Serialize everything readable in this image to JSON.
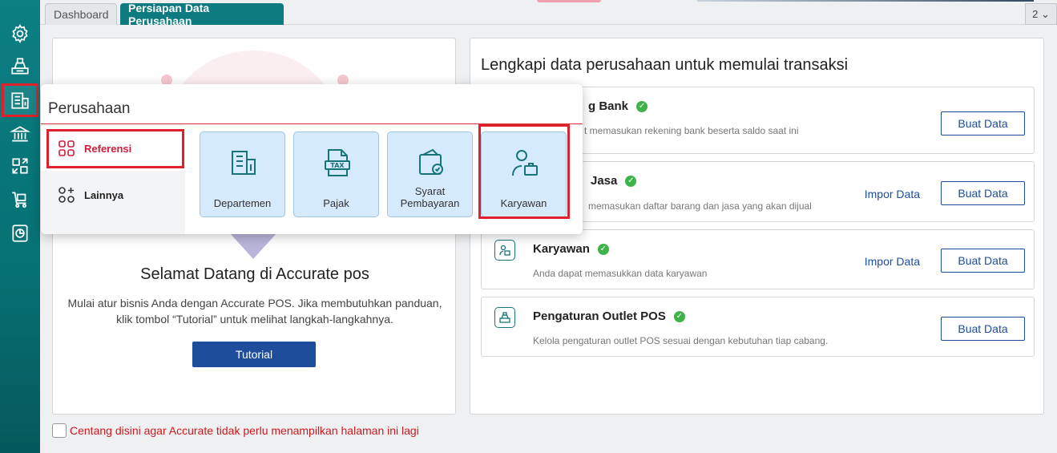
{
  "tabs": {
    "dashboard": "Dashboard",
    "persiapan": "Persiapan Data Perusahaan",
    "count": "2 ⌄"
  },
  "welcome": {
    "title": "Selamat Datang di Accurate pos",
    "description": "Mulai atur bisnis Anda dengan Accurate POS. Jika membutuhkan panduan, klik tombol “Tutorial” untuk melihat langkah-langkahnya.",
    "tutorial_button": "Tutorial"
  },
  "dont_show": "Centang disini agar Accurate tidak perlu menampilkan halaman ini lagi",
  "setup": {
    "title": "Lengkapi data perusahaan untuk memulai transaksi",
    "cards": [
      {
        "title": "g Bank",
        "description": "t memasukan rekening bank beserta saldo saat ini",
        "impor": "",
        "buat": "Buat Data"
      },
      {
        "title": "Jasa",
        "description": "memasukan daftar barang dan jasa yang akan dijual",
        "impor": "Impor Data",
        "buat": "Buat Data"
      },
      {
        "title": "Karyawan",
        "description": "Anda dapat memasukkan data karyawan",
        "impor": "Impor Data",
        "buat": "Buat Data"
      },
      {
        "title": "Pengaturan Outlet POS",
        "description": "Kelola pengaturan outlet POS sesuai dengan kebutuhan tiap cabang.",
        "impor": "",
        "buat": "Buat Data"
      }
    ]
  },
  "popup": {
    "title": "Perusahaan",
    "menu": {
      "referensi": "Referensi",
      "lainnya": "Lainnya"
    },
    "tiles": {
      "departemen": "Departemen",
      "pajak": "Pajak",
      "syarat_1": "Syarat",
      "syarat_2": "Pembayaran",
      "karyawan": "Karyawan"
    }
  },
  "colors": {
    "sidebar": "#0b7f82",
    "accent_blue": "#1e4d9b",
    "highlight_red": "#e0212b",
    "ok_green": "#3db34a",
    "tile_bg": "#d6eafd"
  }
}
